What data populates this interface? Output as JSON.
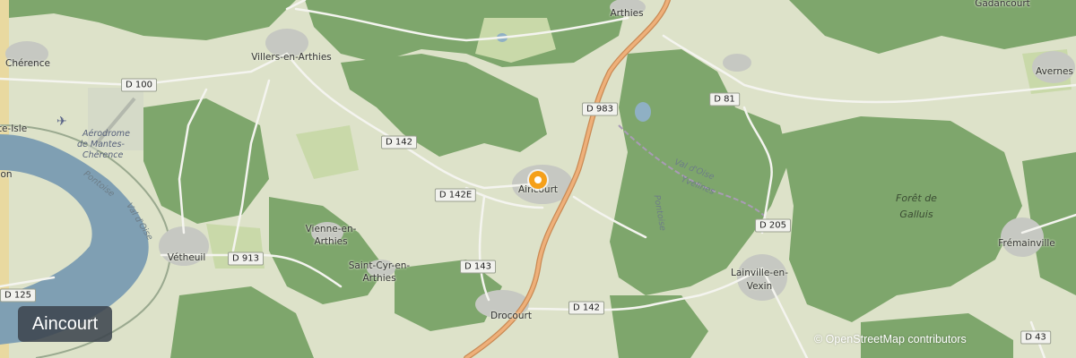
{
  "badge": {
    "label": "Aincourt"
  },
  "attribution": {
    "text": "© OpenStreetMap contributors"
  },
  "marker": {
    "name": "Aincourt",
    "color": "#f5a01a"
  },
  "colors": {
    "forest": "#7da56b",
    "farmland": "#dfe4cb",
    "water": "#7f9fb3",
    "motorway": "#e9a96a",
    "road": "#ffffff"
  },
  "places": {
    "cherence": "Chérence",
    "villers_en_arthies": "Villers-en-Arthies",
    "arthies": "Arthies",
    "avernes": "Avernes",
    "aincourt": "Aincourt",
    "vienne_en_arthies_line1": "Vienne-en-",
    "vienne_en_arthies_line2": "Arthies",
    "saint_cyr_line1": "Saint-Cyr-en-",
    "saint_cyr_line2": "Arthies",
    "vetheuil": "Vétheuil",
    "drocourt": "Drocourt",
    "lainville_line1": "Lainville-en-",
    "lainville_line2": "Vexin",
    "fremainville": "Frémainville",
    "isle_partial": "te-Isle",
    "on_partial": "on",
    "gadancourt_partial": "Gadancourt"
  },
  "roads": {
    "d100": "D 100",
    "d142_north": "D 142",
    "d142e": "D 142E",
    "d143": "D 143",
    "d142_south": "D 142",
    "d913": "D 913",
    "d983": "D 983",
    "d81": "D 81",
    "d205": "D 205",
    "d125": "D 125",
    "d43": "D 43"
  },
  "features": {
    "aerodrome_line1": "Aérodrome",
    "aerodrome_line2": "de Mantes-",
    "aerodrome_line3": "Chérence",
    "foret_line1": "Forêt de",
    "foret_line2": "Galluis",
    "val_doise_east": "Val d'Oise",
    "val_doise_west": "Val d'Oise",
    "yvelines": "Yvelines",
    "pontoise_east": "Pontoise",
    "pontoise_west": "Pontoise"
  }
}
